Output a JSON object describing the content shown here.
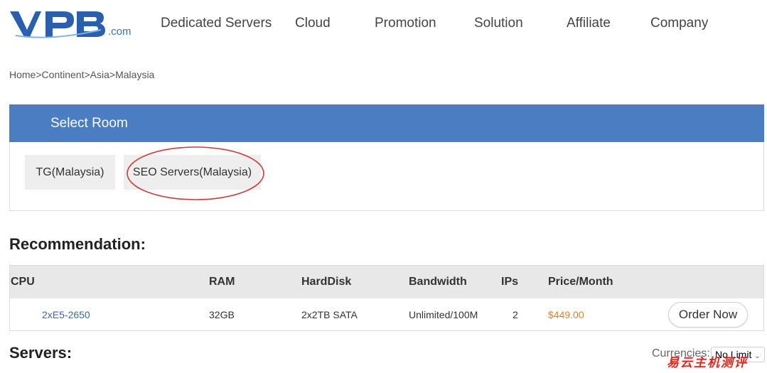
{
  "brand": {
    "logo_text": "VPB",
    "domain_suffix": ".com",
    "color": "#2a5fae"
  },
  "nav": {
    "items": [
      {
        "label": "Dedicated Servers"
      },
      {
        "label": "Cloud"
      },
      {
        "label": "Promotion"
      },
      {
        "label": "Solution"
      },
      {
        "label": "Affiliate"
      },
      {
        "label": "Company"
      }
    ]
  },
  "breadcrumb": {
    "items": [
      "Home",
      "Continent",
      "Asia",
      "Malaysia"
    ],
    "separator": ">"
  },
  "room_selector": {
    "title": "Select Room",
    "header_color": "#4a7dc2",
    "options": [
      {
        "label": "TG(Malaysia)"
      },
      {
        "label": "SEO Servers(Malaysia)",
        "highlighted": true
      }
    ]
  },
  "recommendation": {
    "title": "Recommendation:",
    "columns": [
      "CPU",
      "RAM",
      "HardDisk",
      "Bandwidth",
      "IPs",
      "Price/Month"
    ],
    "rows": [
      {
        "cpu": "2xE5-2650",
        "ram": "32GB",
        "harddisk": "2x2TB SATA",
        "bandwidth": "Unlimited/100M",
        "ips": "2",
        "price": "$449.00",
        "action": "Order Now"
      }
    ],
    "price_color": "#d9822b",
    "link_color": "#3c67a8"
  },
  "servers": {
    "title": "Servers:",
    "currency_label": "Currencies:",
    "currency_value": "No Limit"
  },
  "watermark": {
    "text": "易云主机测评",
    "color": "#e0261b"
  }
}
